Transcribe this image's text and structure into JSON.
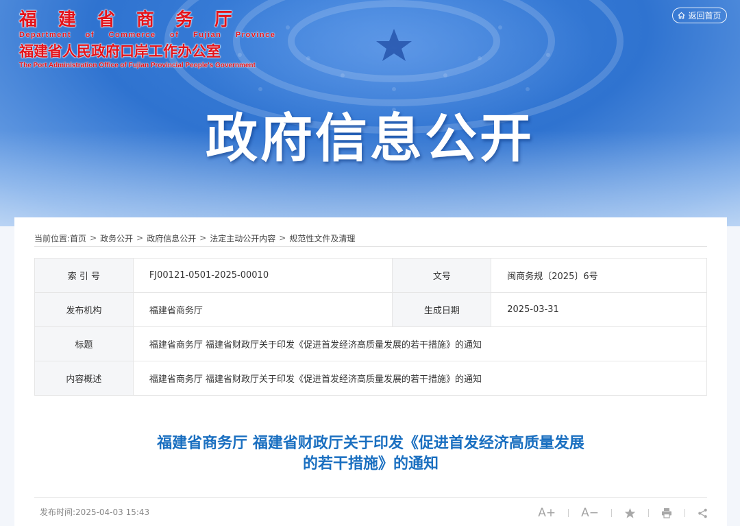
{
  "header": {
    "logo": {
      "cn_line1": "福建省商务厅",
      "en_line1": "Department of Commerce of Fujian Province",
      "cn_line2": "福建省人民政府口岸工作办公室",
      "en_line2": "The Port Administration Office of Fujian Provincial People's Government"
    },
    "home_button": "返回首页",
    "banner_title": "政府信息公开"
  },
  "breadcrumb": {
    "prefix": "当前位置:",
    "items": [
      "首页",
      "政务公开",
      "政府信息公开",
      "法定主动公开内容",
      "规范性文件及清理"
    ],
    "separator": ">"
  },
  "info_table": {
    "index_label": "索 引 号",
    "index_value": "FJ00121-0501-2025-00010",
    "docno_label": "文号",
    "docno_value": "闽商务规〔2025〕6号",
    "org_label": "发布机构",
    "org_value": "福建省商务厅",
    "date_label": "生成日期",
    "date_value": "2025-03-31",
    "title_label": "标题",
    "title_value": "福建省商务厅 福建省财政厅关于印发《促进首发经济高质量发展的若干措施》的通知",
    "summary_label": "内容概述",
    "summary_value": "福建省商务厅 福建省财政厅关于印发《促进首发经济高质量发展的若干措施》的通知"
  },
  "article": {
    "title_line1": "福建省商务厅 福建省财政厅关于印发《促进首发经济高质量发展",
    "title_line2": "的若干措施》的通知",
    "publish_time": "发布时间:2025-04-03 15:43"
  },
  "tools": {
    "font_larger": "A+",
    "font_smaller": "A−"
  },
  "colors": {
    "brand_red": "#e4141b",
    "title_blue": "#1a6fc0",
    "banner_blue": "#2f73d0"
  }
}
